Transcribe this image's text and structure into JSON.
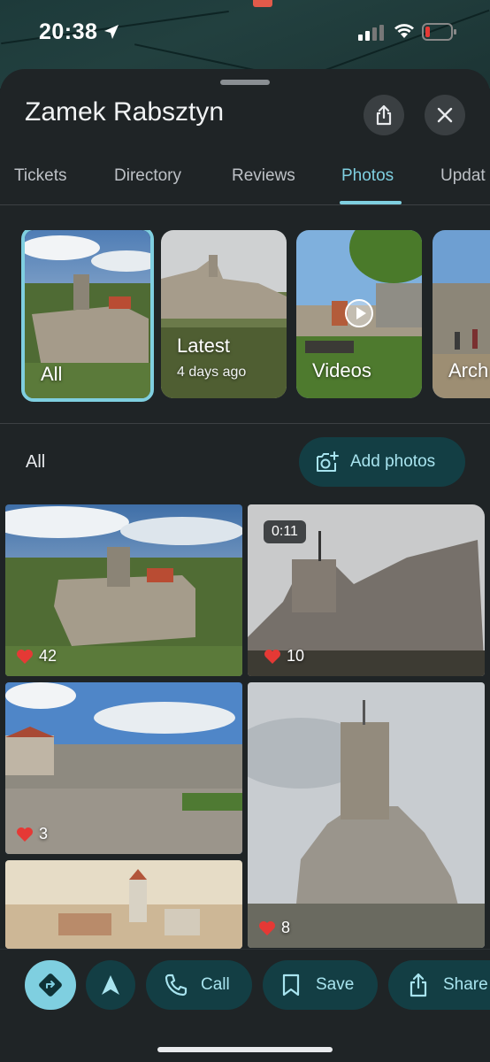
{
  "status_bar": {
    "time": "20:38"
  },
  "place": {
    "title": "Zamek Rabsztyn"
  },
  "tabs": [
    {
      "label": "Tickets"
    },
    {
      "label": "Directory"
    },
    {
      "label": "Reviews"
    },
    {
      "label": "Photos",
      "active": true
    },
    {
      "label": "Updat"
    }
  ],
  "categories": [
    {
      "label": "All",
      "selected": true
    },
    {
      "label": "Latest",
      "sub": "4 days ago"
    },
    {
      "label": "Videos"
    },
    {
      "label": "Arch"
    }
  ],
  "photos_section": {
    "title": "All",
    "add_label": "Add photos"
  },
  "photos": [
    {
      "likes": "42"
    },
    {
      "likes": "10",
      "duration": "0:11"
    },
    {
      "likes": "3"
    },
    {
      "likes": "8"
    },
    {
      "likes": ""
    }
  ],
  "actions": {
    "call": "Call",
    "save": "Save",
    "share": "Share"
  },
  "colors": {
    "accent": "#7fcfe0",
    "button_bg": "#133e44",
    "heart": "#e53935"
  }
}
